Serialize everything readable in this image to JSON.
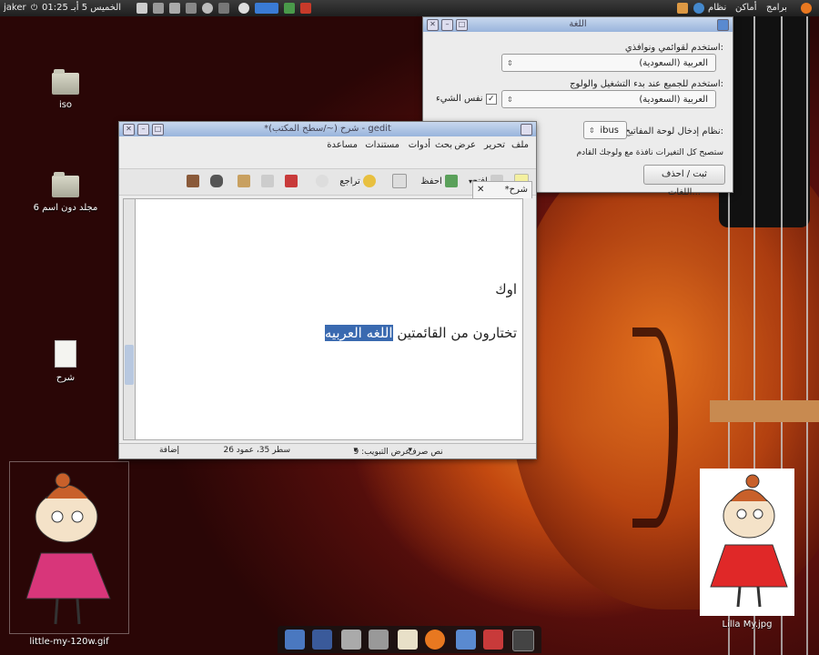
{
  "top_panel": {
    "user": "jaker",
    "datetime": "الخميس 5 أبـ 01:25",
    "left_menu": "برامج",
    "right_menu_1": "أماكن",
    "right_menu_2": "نظام"
  },
  "desktop": {
    "icons": [
      {
        "label": "iso"
      },
      {
        "label": "مجلد دون اسم 6"
      },
      {
        "label": "شرح"
      }
    ],
    "images": [
      {
        "label": "little-my-120w.gif"
      },
      {
        "label": "Lilla My.jpg"
      }
    ]
  },
  "language_dialog": {
    "title": "اللغة",
    "label_menus": "استخدم لقوائمي ونوافذي:",
    "combo_menus": "العربية (السعودية)",
    "label_startup": "استخدم للجميع عند بدء التشغيل والولوج:",
    "combo_startup": "العربية (السعودية)",
    "same_checkbox": "نفس الشيء",
    "label_input": "نظام إدخال لوحة المفاتيح:",
    "combo_input": "ibus",
    "note": "ستصبح كل التغيرات نافذة مع ولوجك القادم",
    "button": "ثبت / احذف اللغات..."
  },
  "gedit": {
    "title": "*شرح (~/سطح المكتب) - gedit",
    "menu": [
      "ملف",
      "تحرير",
      "عرض",
      "بحث",
      "أدوات",
      "مستندات",
      "مساعدة"
    ],
    "toolbar": {
      "open": "افتح",
      "save": "احفظ",
      "undo": "تراجع"
    },
    "tab_label": "*شرح",
    "content_line1": "اوك",
    "content_line2_plain": "تختارون من القائمتين ",
    "content_line2_sel": "اللغه العربيه",
    "status": {
      "mode": "نص صرف",
      "tab_width": "عرض التبويب: 9",
      "position": "سطر 35، عمود 26",
      "insert": "إضافة"
    }
  },
  "colors": {
    "accent": "#3a7bd5",
    "selection": "#3a6ab0",
    "titlebar": "#a8c0e0"
  }
}
